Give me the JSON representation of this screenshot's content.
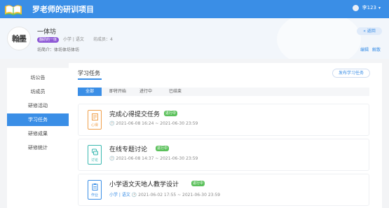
{
  "header": {
    "title": "罗老师的研训项目",
    "user_name": "李123"
  },
  "workshop": {
    "logo_text": "翰墨",
    "name": "一体坊",
    "tag": "翻研的一体",
    "meta": "小学 | 语文",
    "count_label": "坊成员：4",
    "intro": "坊简介：体坊体坊体坊",
    "back_label": "« 返回",
    "edit_label": "编辑",
    "dismiss_label": "解散"
  },
  "sidebar": {
    "items": [
      {
        "label": "坊公告"
      },
      {
        "label": "坊成员"
      },
      {
        "label": "研修活动"
      },
      {
        "label": "学习任务"
      },
      {
        "label": "研修成果"
      },
      {
        "label": "研修统计"
      }
    ],
    "active_index": 3
  },
  "main": {
    "title": "学习任务",
    "publish_label": "发布学习任务",
    "tabs": [
      {
        "label": "全部"
      },
      {
        "label": "即将开始"
      },
      {
        "label": "进行中"
      },
      {
        "label": "已结束"
      }
    ],
    "active_tab": 0,
    "tasks": [
      {
        "title": "完成心得提交任务",
        "status": "进行中",
        "subject": "",
        "time": "2021-06-08 16:24 ~ 2021-06-30 23:59",
        "type_label": "心得",
        "icon": "notes-icon",
        "color": "#f0a04b"
      },
      {
        "title": "在线专题讨论",
        "status": "进行中",
        "subject": "",
        "time": "2021-06-08 14:37 ~ 2021-06-30 23:59",
        "type_label": "讨论",
        "icon": "discussion-icon",
        "color": "#3ab8b0"
      },
      {
        "title": "小学语文天地人教学设计",
        "status": "进行中",
        "subject": "小学 | 语文",
        "time": "2021-06-02 17:55 ~ 2021-06-30 23:59",
        "type_label": "作业",
        "icon": "homework-icon",
        "color": "#3a8ee6"
      }
    ]
  }
}
